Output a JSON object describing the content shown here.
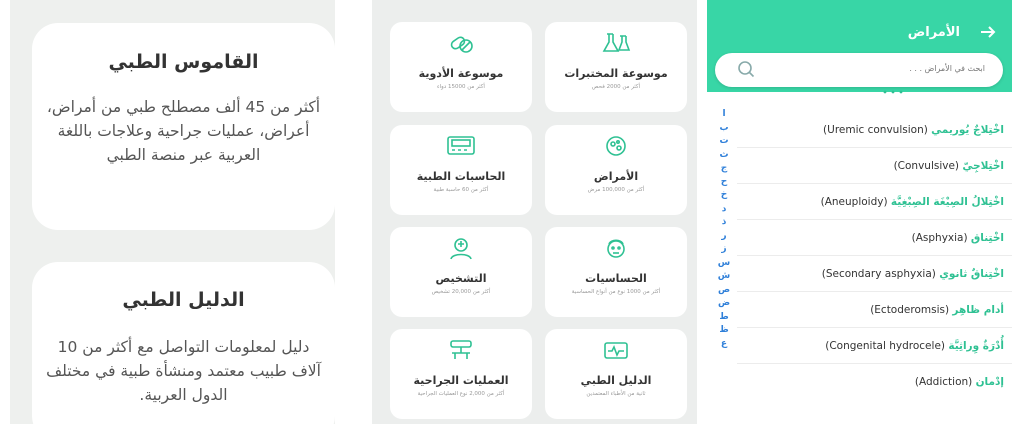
{
  "panel1": {
    "card1": {
      "title": "القاموس الطبي",
      "body": "أكثر من 45 ألف مصطلح طبي من أمراض، أعراض، عمليات جراحية وعلاجات باللغة العربية عبر منصة الطبي"
    },
    "card2": {
      "title": "الدليل الطبي",
      "body": "دليل لمعلومات التواصل مع أكثر من 10 آلاف طبيب معتمد ومنشأة طبية في مختلف الدول العربية."
    }
  },
  "panel2": {
    "tiles": [
      {
        "title": "موسوعة المختبرات",
        "sub": "أكثر من 2000 فحص",
        "icon": "lab-flask-icon"
      },
      {
        "title": "موسوعة الأدوية",
        "sub": "أكثر من 15000 دواء",
        "icon": "pills-icon"
      },
      {
        "title": "الأمراض",
        "sub": "أكثر من 100,000 مرض",
        "icon": "virus-icon"
      },
      {
        "title": "الحاسبات الطبية",
        "sub": "أكثر من 60 حاسبة طبية",
        "icon": "calculator-icon"
      },
      {
        "title": "الحساسيات",
        "sub": "أكثر من 1000 نوع من أنواع الحساسية",
        "icon": "allergy-icon"
      },
      {
        "title": "التشخيص",
        "sub": "أكثر من 20,000 تشخيص",
        "icon": "diagnosis-icon"
      },
      {
        "title": "الدليل الطبي",
        "sub": "ثانية من الأطباء المعتمدين",
        "icon": "medical-directory-icon"
      },
      {
        "title": "العمليات الجراحية",
        "sub": "أكثر من 2,000 نوع العمليات الجراحية",
        "icon": "surgery-icon"
      }
    ]
  },
  "panel3": {
    "title": "الأمراض",
    "search_placeholder": "ابحث في الأمراض . . .",
    "letters": [
      "ا",
      "ب",
      "ت",
      "ث",
      "ج",
      "ح",
      "خ",
      "د",
      "ذ",
      "ر",
      "ز",
      "س",
      "ش",
      "ص",
      "ض",
      "ط",
      "ظ",
      "ع"
    ],
    "diseases": [
      {
        "ar": "اخْتِلاجٌ يُوريمي",
        "en": "(Uremic convulsion)"
      },
      {
        "ar": "اخْتِلاجِيّ",
        "en": "(Convulsive)"
      },
      {
        "ar": "اخْتِلالُ الصِيْغَة الصِبْغِيَّة",
        "en": "(Aneuploidy)"
      },
      {
        "ar": "اخْتِناق",
        "en": "(Asphyxia)"
      },
      {
        "ar": "اخْتِناقٌ ثانوي",
        "en": "(Secondary asphyxia)"
      },
      {
        "ar": "أدام ظاهِر",
        "en": "(Ectoderomsis)"
      },
      {
        "ar": "أُدْرَةٌ وِراثِيَّة",
        "en": "(Congenital hydrocele)"
      },
      {
        "ar": "إدْمان",
        "en": "(Addiction)"
      }
    ]
  },
  "colors": {
    "accent": "#38d6a6",
    "letters": "#2e7fd9",
    "disease_ar": "#2fc193"
  }
}
